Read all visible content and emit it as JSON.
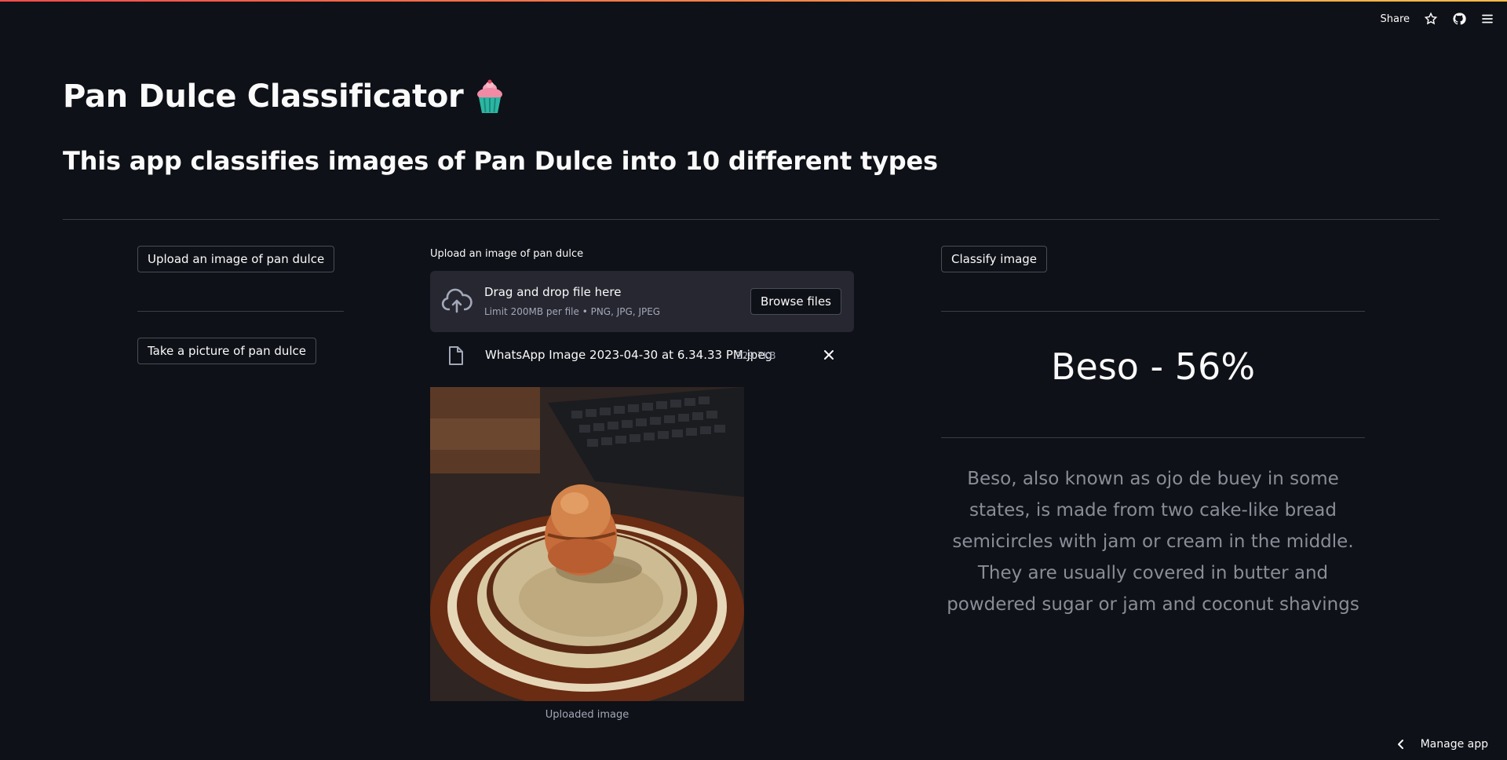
{
  "header": {
    "share_label": "Share"
  },
  "page": {
    "title": "Pan Dulce Classificator",
    "title_emoji_icon": "cupcake-icon",
    "subtitle": "This app classifies images of Pan Dulce into 10 different types"
  },
  "left": {
    "upload_button": "Upload an image of pan dulce",
    "camera_button": "Take a picture of pan dulce"
  },
  "uploader": {
    "label": "Upload an image of pan dulce",
    "drop_title": "Drag and drop file here",
    "limit": "Limit 200MB per file • PNG, JPG, JPEG",
    "browse_label": "Browse files",
    "file": {
      "name": "WhatsApp Image 2023-04-30 at 6.34.33 PM.jpeg",
      "size": "229.7KB"
    },
    "image_caption": "Uploaded image"
  },
  "right": {
    "classify_button": "Classify image",
    "result": "Beso - 56%",
    "description": "Beso, also known as ojo de buey in some states, is made from two cake-like bread semicircles with jam or cream in the middle. They are usually covered in butter and powdered sugar or jam and coconut shavings"
  },
  "footer": {
    "manage_label": "Manage app"
  },
  "colors": {
    "background": "#0e1117",
    "surface": "#262730",
    "accent_start": "#ff4b4b",
    "accent_end": "#ffbd45",
    "muted_text": "#8a8d96"
  }
}
